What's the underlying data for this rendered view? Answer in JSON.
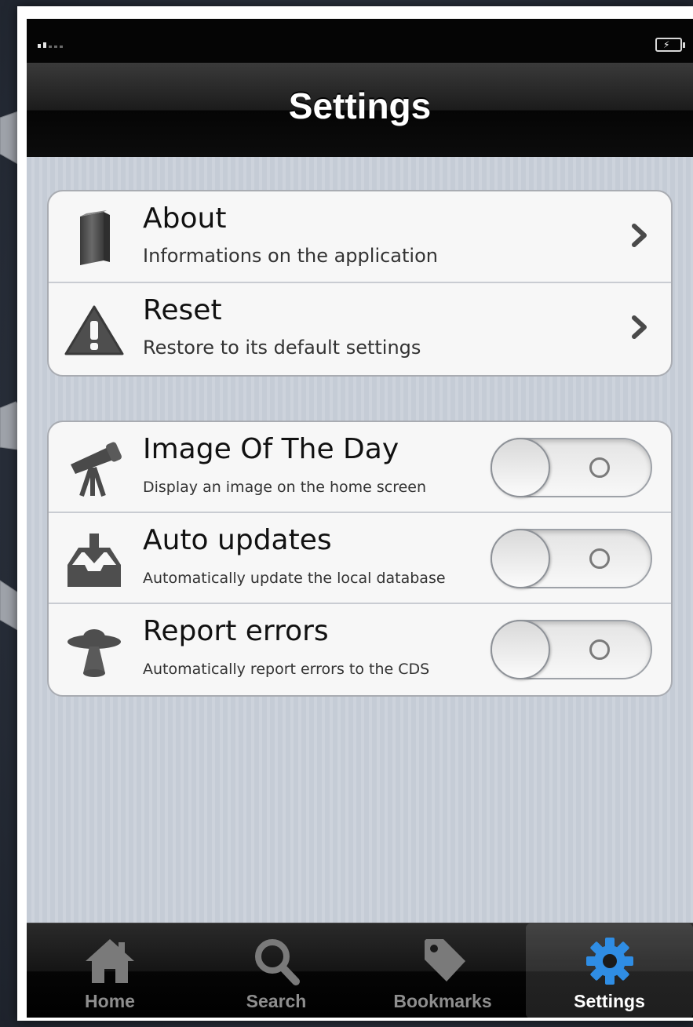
{
  "screen": {
    "title": "Settings"
  },
  "status_bar": {
    "signal_icon": "signal-bars-icon",
    "battery_icon": "battery-charging-icon"
  },
  "groups": [
    {
      "rows": [
        {
          "title": "About",
          "subtitle": "Informations on the application",
          "icon": "book-icon",
          "accessory": "chevron-right-icon"
        },
        {
          "title": "Reset",
          "subtitle": "Restore to its default settings",
          "icon": "warning-icon",
          "accessory": "chevron-right-icon"
        }
      ]
    },
    {
      "rows": [
        {
          "title": "Image Of The Day",
          "subtitle": "Display an image on the home screen",
          "icon": "telescope-icon",
          "toggle_on": false
        },
        {
          "title": "Auto updates",
          "subtitle": "Automatically update the local database",
          "icon": "inbox-download-icon",
          "toggle_on": false
        },
        {
          "title": "Report errors",
          "subtitle": "Automatically report errors to the CDS",
          "icon": "ufo-icon",
          "toggle_on": false
        }
      ]
    }
  ],
  "tabbar": {
    "items": [
      {
        "label": "Home",
        "icon": "home-icon",
        "active": false
      },
      {
        "label": "Search",
        "icon": "search-icon",
        "active": false
      },
      {
        "label": "Bookmarks",
        "icon": "tag-icon",
        "active": false
      },
      {
        "label": "Settings",
        "icon": "gear-icon",
        "active": true
      }
    ]
  },
  "colors": {
    "accent_active_tab_icon": "#2f8de4",
    "group_background": "#f7f7f7",
    "content_background": "#c5ccd6"
  }
}
